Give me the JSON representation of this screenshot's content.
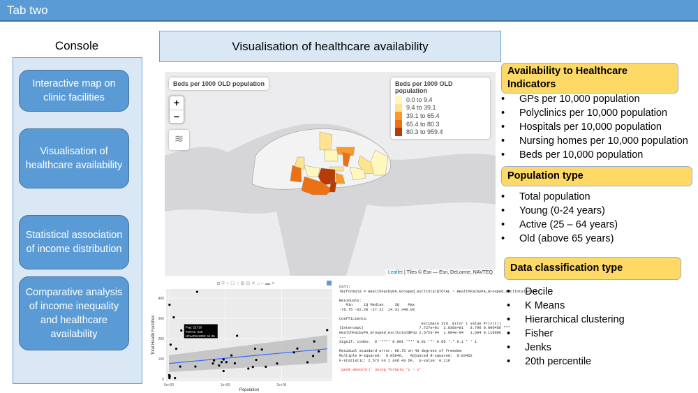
{
  "window": {
    "tab_title": "Tab two"
  },
  "sidebar": {
    "title": "Console",
    "items": [
      {
        "label": "Interactive map on clinic facilities"
      },
      {
        "label": "Visualisation of healthcare availability"
      },
      {
        "label": "Statistical association of income distribution"
      },
      {
        "label": "Comparative analysis of income inequality and healthcare availability"
      }
    ]
  },
  "main": {
    "title": "Visualisation of healthcare availability"
  },
  "map": {
    "title": "Beds per 1000 OLD population",
    "zoom_in": "+",
    "zoom_out": "−",
    "layers_icon": "layers-icon",
    "legend": {
      "title": "Beds per 1000 OLD population",
      "items": [
        {
          "label": "0.0 to 9.4",
          "color": "#fff7bc"
        },
        {
          "label": "9.4 to 39.1",
          "color": "#fee391"
        },
        {
          "label": "39.1 to 65.4",
          "color": "#fe9929"
        },
        {
          "label": "65.4 to 80.3",
          "color": "#ec7014"
        },
        {
          "label": "80.3 to 959.4",
          "color": "#b83a04"
        }
      ]
    },
    "attribution_link": "Leaflet",
    "attribution_text": " | Tiles © Esri — Esri, DeLorme, NAVTEQ"
  },
  "chart_data": {
    "type": "scatter",
    "xlabel": "Population",
    "ylabel": "Total Health Facilities",
    "xlim": [
      -5000,
      290000
    ],
    "ylim": [
      -10,
      445
    ],
    "xticks": [
      "0e+00",
      "1e+05",
      "2e+05"
    ],
    "xtick_values": [
      0,
      100000,
      200000
    ],
    "yticks": [
      "0",
      "100",
      "200",
      "300",
      "400"
    ],
    "ytick_values": [
      0,
      100,
      200,
      300,
      400
    ],
    "grid": true,
    "points": [
      [
        1000,
        367
      ],
      [
        50000,
        431
      ],
      [
        8500,
        305
      ],
      [
        22000,
        240
      ],
      [
        3000,
        170
      ],
      [
        13000,
        150
      ],
      [
        20000,
        62
      ],
      [
        10700,
        5
      ],
      [
        500,
        20
      ],
      [
        800,
        10
      ],
      [
        1000,
        5
      ],
      [
        1500,
        15
      ],
      [
        47000,
        62
      ],
      [
        78000,
        77
      ],
      [
        80000,
        92
      ],
      [
        89000,
        67
      ],
      [
        93500,
        84
      ],
      [
        97000,
        97
      ],
      [
        97000,
        40
      ],
      [
        102000,
        84
      ],
      [
        111000,
        117
      ],
      [
        117000,
        78
      ],
      [
        121000,
        214
      ],
      [
        141000,
        52
      ],
      [
        149000,
        60
      ],
      [
        153000,
        150
      ],
      [
        155000,
        95
      ],
      [
        165000,
        146
      ],
      [
        172000,
        61
      ],
      [
        192000,
        77
      ],
      [
        222000,
        132
      ],
      [
        228000,
        151
      ],
      [
        246000,
        83
      ],
      [
        256000,
        114
      ],
      [
        258000,
        186
      ],
      [
        266000,
        137
      ],
      [
        281000,
        242
      ]
    ],
    "fit": {
      "intercept": 77.27,
      "slope": 0.0002572,
      "x_range": [
        0,
        281000
      ],
      "band_low": [
        35,
        80
      ],
      "band_high": [
        118,
        217
      ]
    },
    "tooltip": [
      "Pop: 21710",
      "TOTAL: 240",
      "HFacPer1000: 11.05"
    ],
    "colors": {
      "points": "#000000",
      "line": "#3366ff",
      "band": "#bdbdbd",
      "panel": "#ebebeb"
    }
  },
  "regression": {
    "lines": [
      "Call:",
      "lm(formula = HealthFacbyPA_Grouped_excltotal$TOTAL ~ HealthFacbyPA_Grouped_excltotal$Pop)",
      "",
      "Residuals:",
      "   Min     1Q Median     3Q    Max",
      "-76.75 -62.20 -27.22  14.31 340.03",
      "",
      "Coefficients:",
      "                                     Estimate Std. Error t value Pr(>|t|)",
      "(Intercept)                         7.727e+01  2.036e+01   3.796 0.000456 ***",
      "HealthFacbyPA_Grouped_excltotal$Pop 2.572e-04  1.604e-04   1.604 0.116006",
      "---",
      "Signif. codes:  0 '***' 0.001 '**' 0.01 '*' 0.05 '.' 0.1 ' ' 1",
      "",
      "Residual standard error: 96.75 on 43 degrees of freedom",
      "Multiple R-squared:  0.05646,\tAdjusted R-squared:  0.03452",
      "F-statistic: 2.573 on 1 and 43 DF,  p-value: 0.116",
      ""
    ],
    "warning": "`geom_smooth()` using formula 'y ~ x'"
  },
  "right": {
    "indicators": {
      "title": "Availability to Healthcare Indicators",
      "items": [
        "GPs per 10,000 population",
        "Polyclinics per 10,000 population",
        "Hospitals per 10,000 population",
        "Nursing homes per 10,000 population",
        "Beds per 10,000 population"
      ]
    },
    "population": {
      "title": "Population type",
      "items": [
        "Total population",
        "Young (0-24 years)",
        "Active (25 – 64 years)",
        "Old (above 65 years)"
      ]
    },
    "classification": {
      "title": "Data classification type",
      "items": [
        "Decile",
        "K Means",
        "Hierarchical clustering",
        "Fisher",
        "Jenks",
        "20th percentile"
      ]
    }
  }
}
